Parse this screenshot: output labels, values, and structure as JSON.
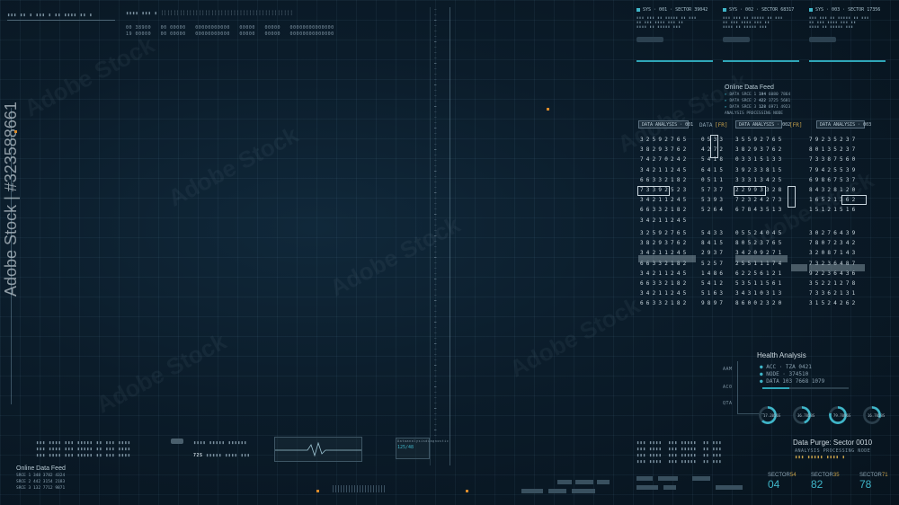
{
  "watermark": {
    "text": "Adobe Stock",
    "side_id": "Adobe Stock | #323588661"
  },
  "systems": [
    {
      "label": "SYS · 001 · SECTOR 39042"
    },
    {
      "label": "SYS · 002 · SECTOR 68317"
    },
    {
      "label": "SYS · 003 · SECTOR 17356"
    }
  ],
  "feed": {
    "title": "Online Data Feed",
    "rows": [
      {
        "label": "DATA SRCE 1",
        "a": "194",
        "b": "6080",
        "c": "7864"
      },
      {
        "label": "DATA SRCE 2",
        "a": "422",
        "b": "3725",
        "c": "5681"
      },
      {
        "label": "DATA SRCE 3",
        "a": "128",
        "b": "6971",
        "c": "4923"
      }
    ],
    "footer": "ANALYSIS PROCESSING NODE"
  },
  "analysis_headers": [
    "DATA ANALYSIS · 001",
    "DATA",
    "[FR]",
    "DATA ANALYSIS · 002",
    "[FR]",
    "DATA ANALYSIS · 003"
  ],
  "digit_columns": [
    "32592765\n38293762\n74270242\n34211245\n66332182\n73392523\n34211245\n66332182\n34211245",
    "0533\n4272\n5418\n6415\n0511\n5737\n5393\n5264",
    "35592765\n38293762\n03315133\n39233815\n33313425\n22993328\n72324273\n67843513",
    "79235237\n80135237\n73387560\n79425539\n69867537\n84328120\n16521362\n15121516",
    "32592765\n38293762\n34211245\n66332182\n34211245\n66332182\n34211245\n66332182",
    "5433\n8415\n2937\n5257\n1486\n5412\n5163\n9897",
    "05524045\n80523765\n34209271\n25511174\n62256121\n53511561\n34310313\n86002320",
    "30276439\n78072342\n32087143\n73236487\n92236436\n35221278\n73362131\n31524262"
  ],
  "health": {
    "title": "Health Analysis",
    "axis": [
      "AAM",
      "AC0",
      "QTA"
    ],
    "rows": [
      "ACC · TZA 0421",
      "NODE · 374510",
      "DATA  103  7668 1079"
    ],
    "gauges": [
      {
        "label": "17.2056S",
        "pct": 0.62
      },
      {
        "label": "36.7058S",
        "pct": 0.45
      },
      {
        "label": "79.7096S",
        "pct": 0.79
      },
      {
        "label": "16.7058S",
        "pct": 0.3
      }
    ]
  },
  "purge": {
    "title": "Data Purge: Sector 0010",
    "sub": "ANALYSIS PROCESSING NODE"
  },
  "sectors": [
    {
      "label": "SECTOR",
      "suffix": "54",
      "value": "04"
    },
    {
      "label": "SECTOR",
      "suffix": "35",
      "value": "82"
    },
    {
      "label": "SECTOR",
      "suffix": "71",
      "value": "78"
    }
  ],
  "left_feed": {
    "title": "Online Data Feed",
    "rows": [
      "SRCE 1  348  3782  4324",
      "SRCE 2  442  3154  2183",
      "SRCE 3  132  7712  9871"
    ]
  },
  "top_left": {
    "lines": [
      "00 38900   00 00000   00000000000   00000   00000   00000000000000",
      "19 00000   00 00000   00000000000   00000   00000   00000000000000"
    ]
  },
  "center_panel": {
    "code": "72S",
    "title": "Dataanalysisdiagnostic",
    "value": "125/48"
  },
  "colors": {
    "accent": "#3fb5c8",
    "bg": "#0b1c2a"
  }
}
